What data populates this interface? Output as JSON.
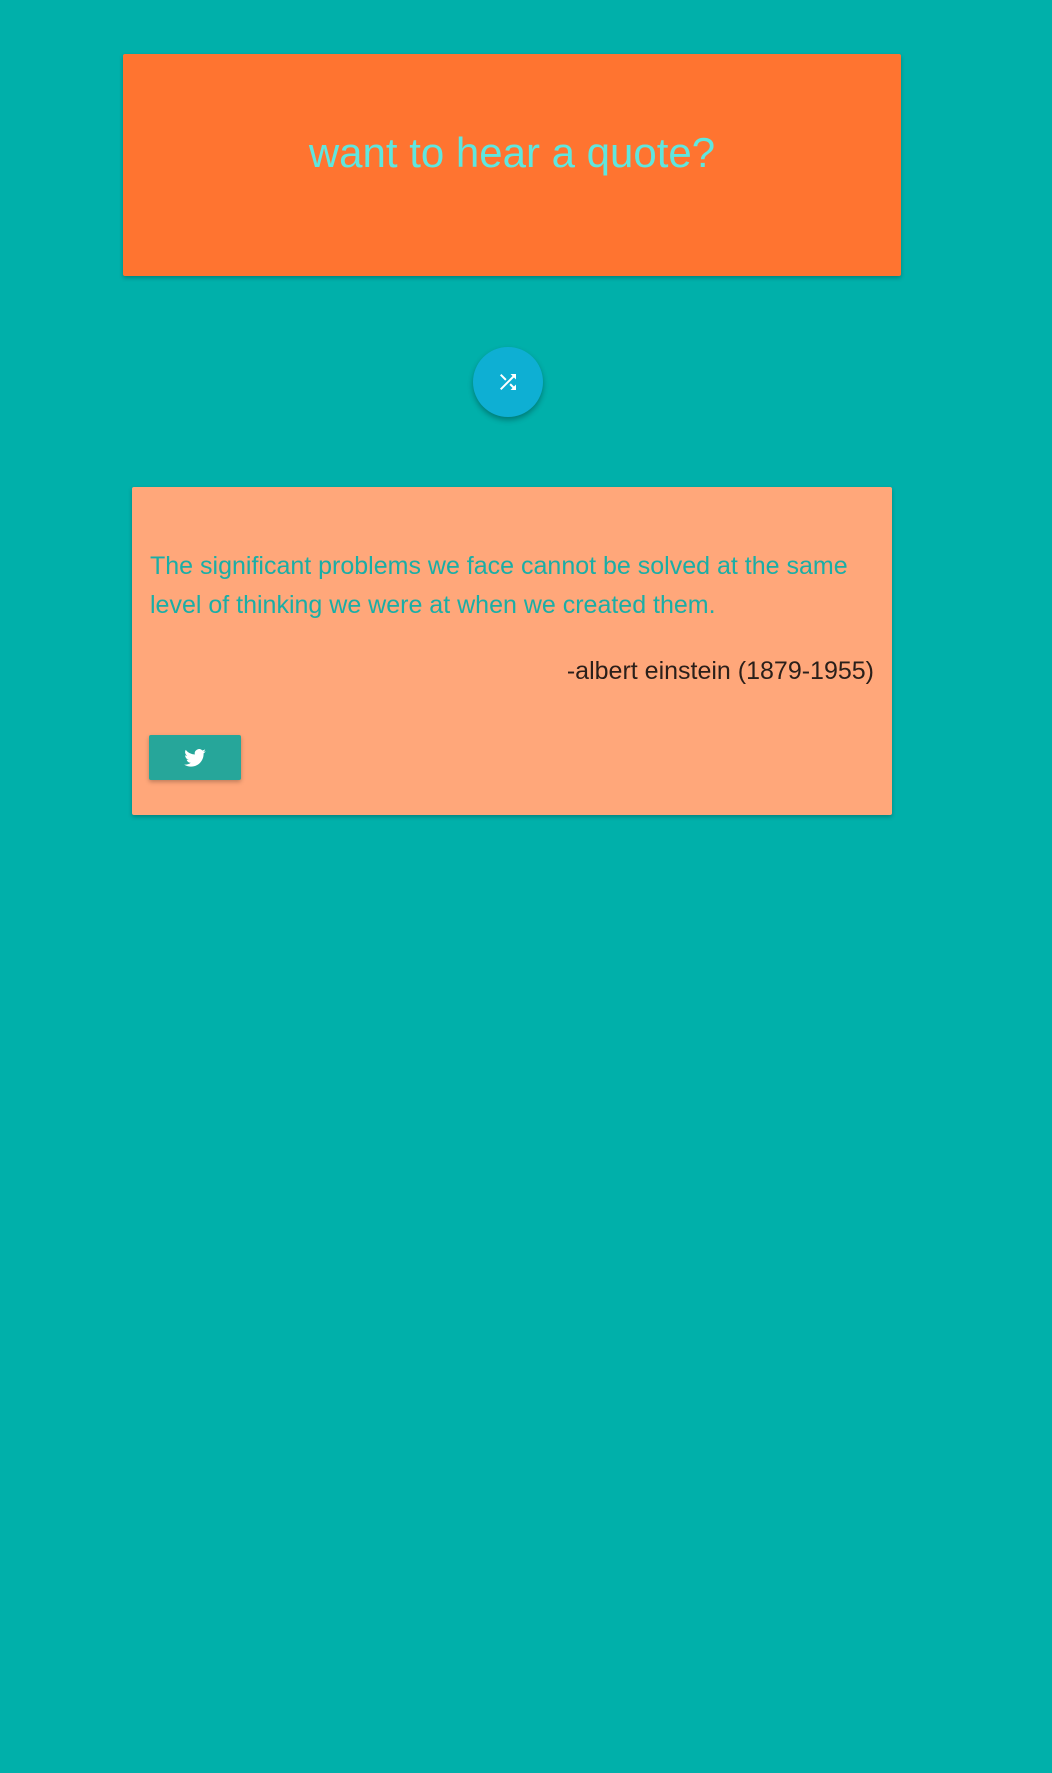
{
  "header": {
    "title": "want to hear a quote?"
  },
  "shuffle_button": {
    "icon": "shuffle-icon"
  },
  "quote": {
    "text": "The significant problems we face cannot be solved at the same level of thinking we were at when we created them.",
    "author": "-albert einstein (1879-1955)"
  },
  "tweet_button": {
    "icon": "twitter-icon"
  },
  "colors": {
    "background": "#00b0aa",
    "header_bg": "#ff7430",
    "header_text": "#5fe6de",
    "shuffle_bg": "#0eafd3",
    "quote_bg": "#ffa77a",
    "quote_text": "#1aaea6",
    "author_text": "#2a1f1a",
    "tweet_bg": "#26a69a"
  }
}
